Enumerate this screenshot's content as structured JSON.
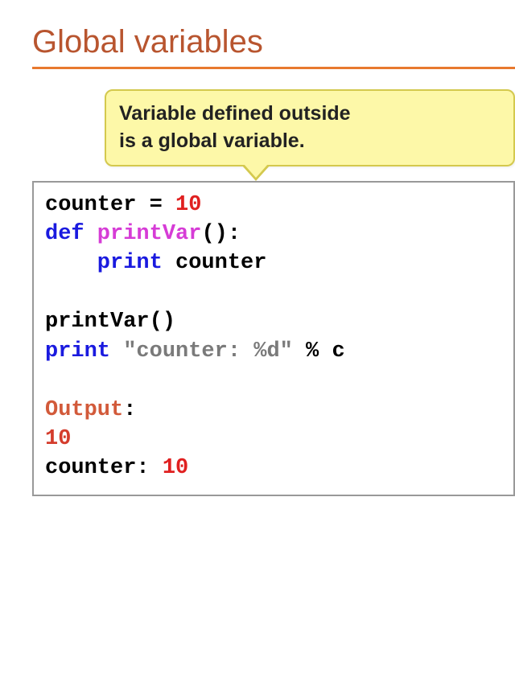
{
  "title": "Global variables",
  "callout": {
    "line1": "Variable defined outside",
    "line2": "is a global variable."
  },
  "code": {
    "l1_lhs": "counter = ",
    "l1_val": "10",
    "l2_def": "def",
    "l2_name": " printVar",
    "l2_paren": "():",
    "l3_print": "    print",
    "l3_arg": " counter",
    "l4_call": "printVar()",
    "l5_print": "print",
    "l5_str": " \"counter: %d\"",
    "l5_pct": " % ",
    "l5_tail": "c",
    "output_label": "Output",
    "output_colon": ":",
    "out1": "10",
    "out2_prefix": "counter: ",
    "out2_val": "10"
  }
}
